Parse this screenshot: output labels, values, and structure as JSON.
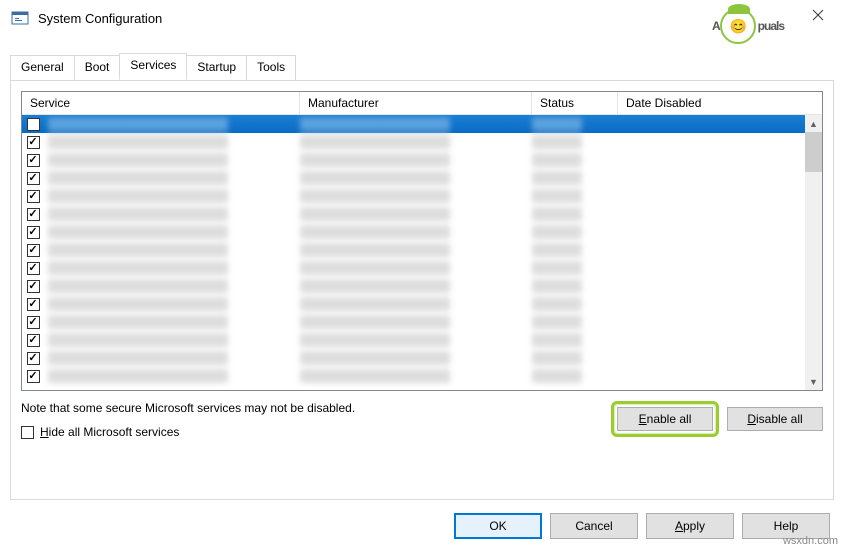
{
  "window": {
    "title": "System Configuration"
  },
  "watermark": {
    "brand": "Appuals",
    "url": "wsxdn.com"
  },
  "tabs": {
    "general": "General",
    "boot": "Boot",
    "services": "Services",
    "startup": "Startup",
    "tools": "Tools",
    "active": "services"
  },
  "columns": {
    "service": "Service",
    "manufacturer": "Manufacturer",
    "status": "Status",
    "date_disabled": "Date Disabled"
  },
  "rows": [
    {
      "checked": false,
      "selected": true
    },
    {
      "checked": true,
      "selected": false
    },
    {
      "checked": true,
      "selected": false
    },
    {
      "checked": true,
      "selected": false
    },
    {
      "checked": true,
      "selected": false
    },
    {
      "checked": true,
      "selected": false
    },
    {
      "checked": true,
      "selected": false
    },
    {
      "checked": true,
      "selected": false
    },
    {
      "checked": true,
      "selected": false
    },
    {
      "checked": true,
      "selected": false
    },
    {
      "checked": true,
      "selected": false
    },
    {
      "checked": true,
      "selected": false
    },
    {
      "checked": true,
      "selected": false
    },
    {
      "checked": true,
      "selected": false
    },
    {
      "checked": true,
      "selected": false
    }
  ],
  "note": "Note that some secure Microsoft services may not be disabled.",
  "hide_ms": {
    "prefix": "",
    "underline": "H",
    "rest": "ide all Microsoft services",
    "checked": false
  },
  "buttons": {
    "enable_all": {
      "underline": "E",
      "rest": "nable all"
    },
    "disable_all": {
      "underline": "D",
      "rest": "isable all"
    },
    "ok": "OK",
    "cancel": "Cancel",
    "apply": {
      "underline": "A",
      "rest": "pply"
    },
    "help": "Help"
  }
}
